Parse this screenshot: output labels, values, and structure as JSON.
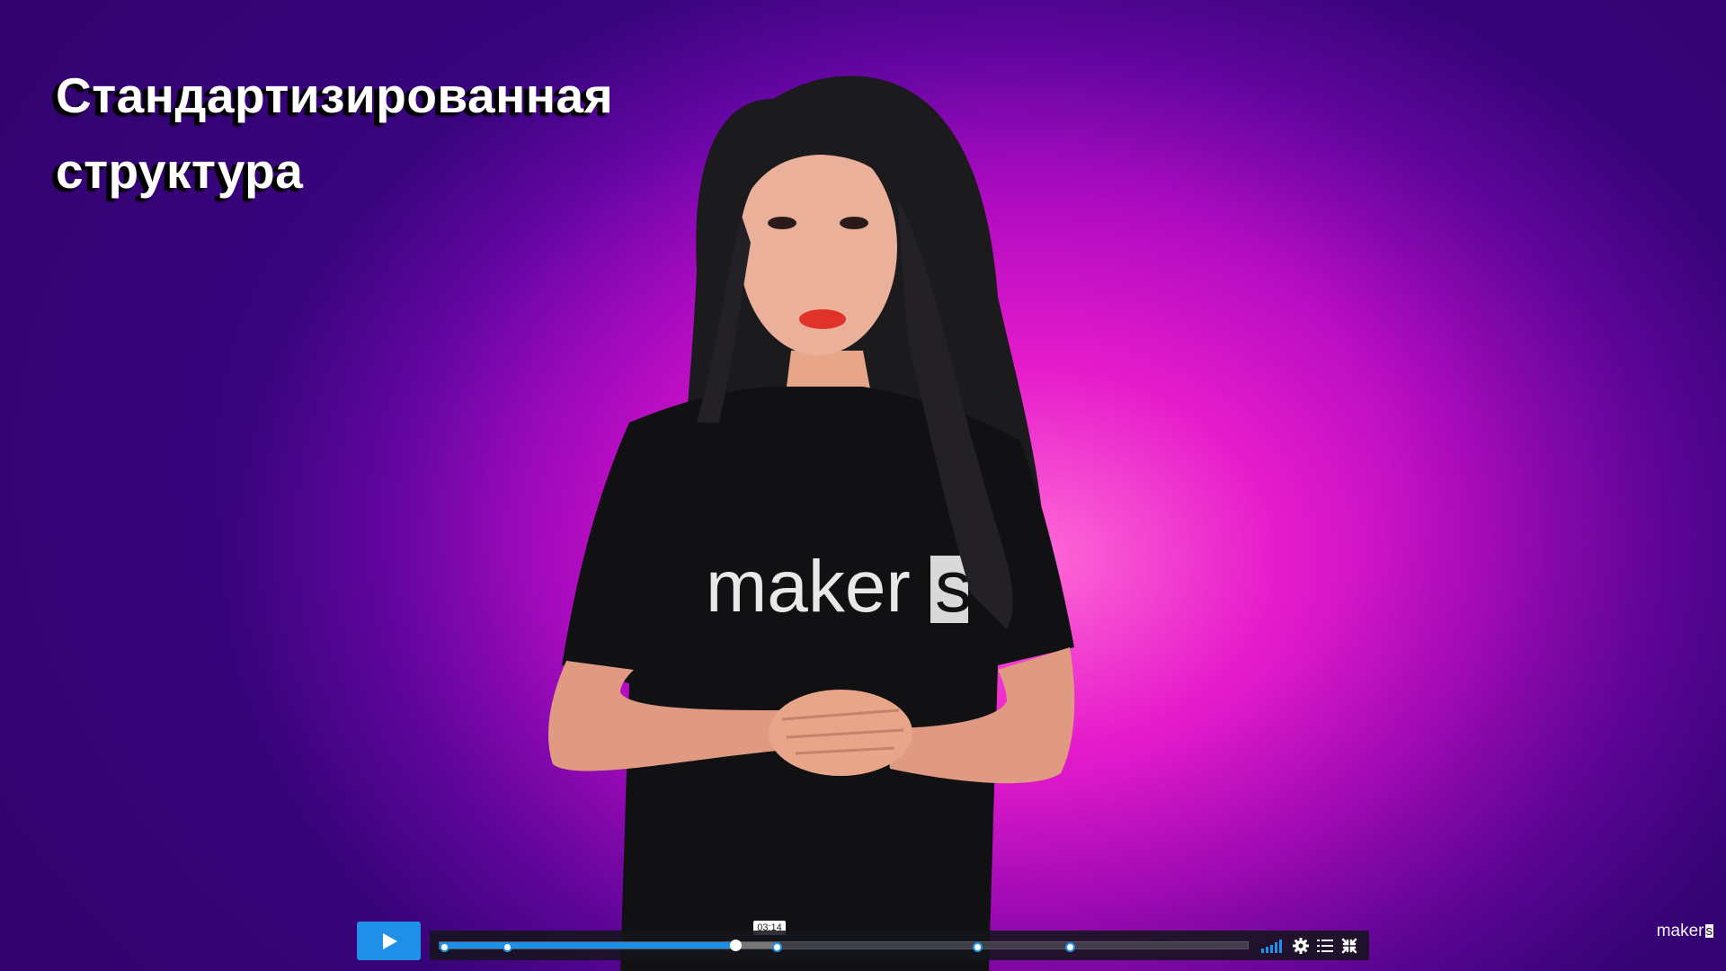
{
  "overlay": {
    "title_line1": "Стандартизированная",
    "title_line2": "структура"
  },
  "shirt": {
    "text": "maker",
    "box_letter": "s"
  },
  "player": {
    "tooltip_time": "03:14",
    "progress_fraction": 0.367,
    "buffered_fraction": 0.42,
    "chapter_marker_fractions": [
      0.0,
      0.083,
      0.417,
      0.665,
      0.78
    ],
    "accent_color": "#1e90e8",
    "icons": {
      "play": "play-icon",
      "quality": "signal-bars-icon",
      "settings": "gear-icon",
      "playlist": "list-icon",
      "fullscreen": "exit-fullscreen-icon"
    }
  },
  "watermark": {
    "text": "maker",
    "box_letter": "s"
  }
}
